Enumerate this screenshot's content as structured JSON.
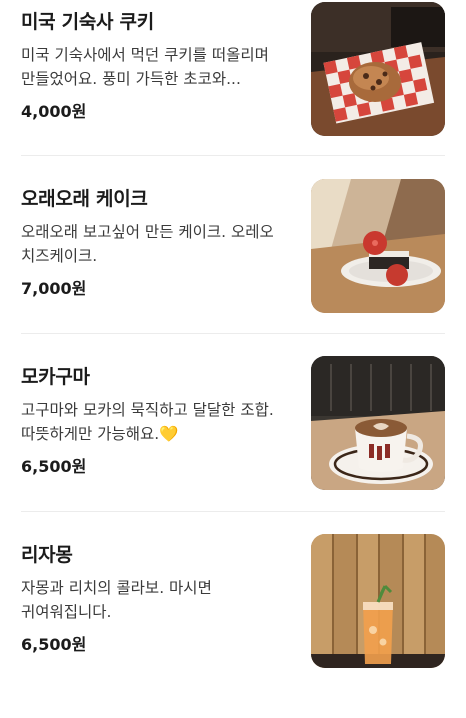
{
  "menu": {
    "items": [
      {
        "name": "미국 기숙사 쿠키",
        "description": "미국 기숙사에서 먹던 쿠키를 떠올리며 만들었어요. 풍미 가득한 초코와...",
        "price": "4,000원",
        "image_icon": "cookie-photo"
      },
      {
        "name": "오래오래 케이크",
        "description": "오래오래 보고싶어 만든 케이크. 오레오 치즈케이크.",
        "price": "7,000원",
        "image_icon": "cake-photo"
      },
      {
        "name": "모카구마",
        "description": "고구마와 모카의 묵직하고 달달한 조합. 따뜻하게만 가능해요.💛",
        "price": "6,500원",
        "image_icon": "latte-photo"
      },
      {
        "name": "리자몽",
        "description": "자몽과 리치의 콜라보. 마시면 귀여워집니다.",
        "price": "6,500원",
        "image_icon": "iced-drink-photo"
      }
    ]
  }
}
